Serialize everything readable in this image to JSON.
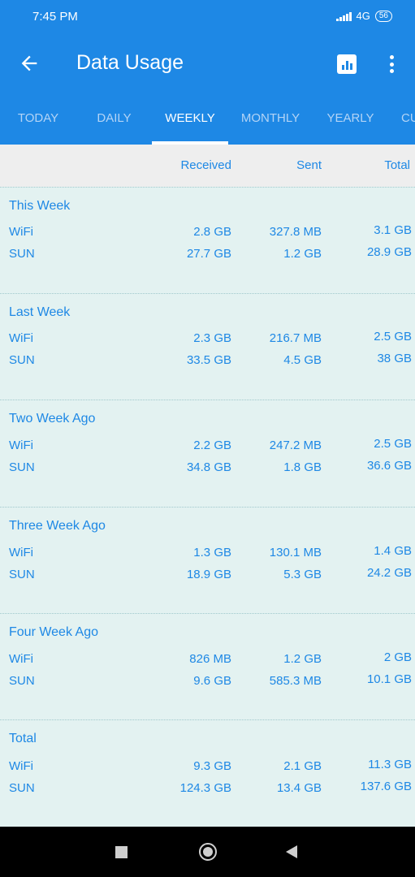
{
  "status_bar": {
    "time": "7:45 PM",
    "network": "4G",
    "battery": "56"
  },
  "app_bar": {
    "title": "Data Usage"
  },
  "tabs": [
    {
      "label": "TODAY"
    },
    {
      "label": "DAILY"
    },
    {
      "label": "WEEKLY"
    },
    {
      "label": "MONTHLY"
    },
    {
      "label": "YEARLY"
    },
    {
      "label": "CU"
    }
  ],
  "active_tab": "WEEKLY",
  "columns": {
    "received": "Received",
    "sent": "Sent",
    "total": "Total"
  },
  "sections": [
    {
      "title": "This Week",
      "rows": [
        {
          "label": "WiFi",
          "received": "2.8 GB",
          "sent": "327.8 MB",
          "total": "3.1 GB"
        },
        {
          "label": "SUN",
          "received": "27.7 GB",
          "sent": "1.2 GB",
          "total": "28.9 GB"
        }
      ]
    },
    {
      "title": "Last Week",
      "rows": [
        {
          "label": "WiFi",
          "received": "2.3 GB",
          "sent": "216.7 MB",
          "total": "2.5 GB"
        },
        {
          "label": "SUN",
          "received": "33.5 GB",
          "sent": "4.5 GB",
          "total": "38 GB"
        }
      ]
    },
    {
      "title": "Two Week Ago",
      "rows": [
        {
          "label": "WiFi",
          "received": "2.2 GB",
          "sent": "247.2 MB",
          "total": "2.5 GB"
        },
        {
          "label": "SUN",
          "received": "34.8 GB",
          "sent": "1.8 GB",
          "total": "36.6 GB"
        }
      ]
    },
    {
      "title": "Three Week Ago",
      "rows": [
        {
          "label": "WiFi",
          "received": "1.3 GB",
          "sent": "130.1 MB",
          "total": "1.4 GB"
        },
        {
          "label": "SUN",
          "received": "18.9 GB",
          "sent": "5.3 GB",
          "total": "24.2 GB"
        }
      ]
    },
    {
      "title": "Four Week Ago",
      "rows": [
        {
          "label": "WiFi",
          "received": "826 MB",
          "sent": "1.2 GB",
          "total": "2 GB"
        },
        {
          "label": "SUN",
          "received": "9.6 GB",
          "sent": "585.3 MB",
          "total": "10.1 GB"
        }
      ]
    },
    {
      "title": "Total",
      "rows": [
        {
          "label": "WiFi",
          "received": "9.3 GB",
          "sent": "2.1 GB",
          "total": "11.3 GB"
        },
        {
          "label": "SUN",
          "received": "124.3 GB",
          "sent": "13.4 GB",
          "total": "137.6 GB"
        }
      ]
    }
  ],
  "colors": {
    "primary": "#1e88e5",
    "background": "#e3f2f1",
    "header_bg": "#eeeeee"
  }
}
